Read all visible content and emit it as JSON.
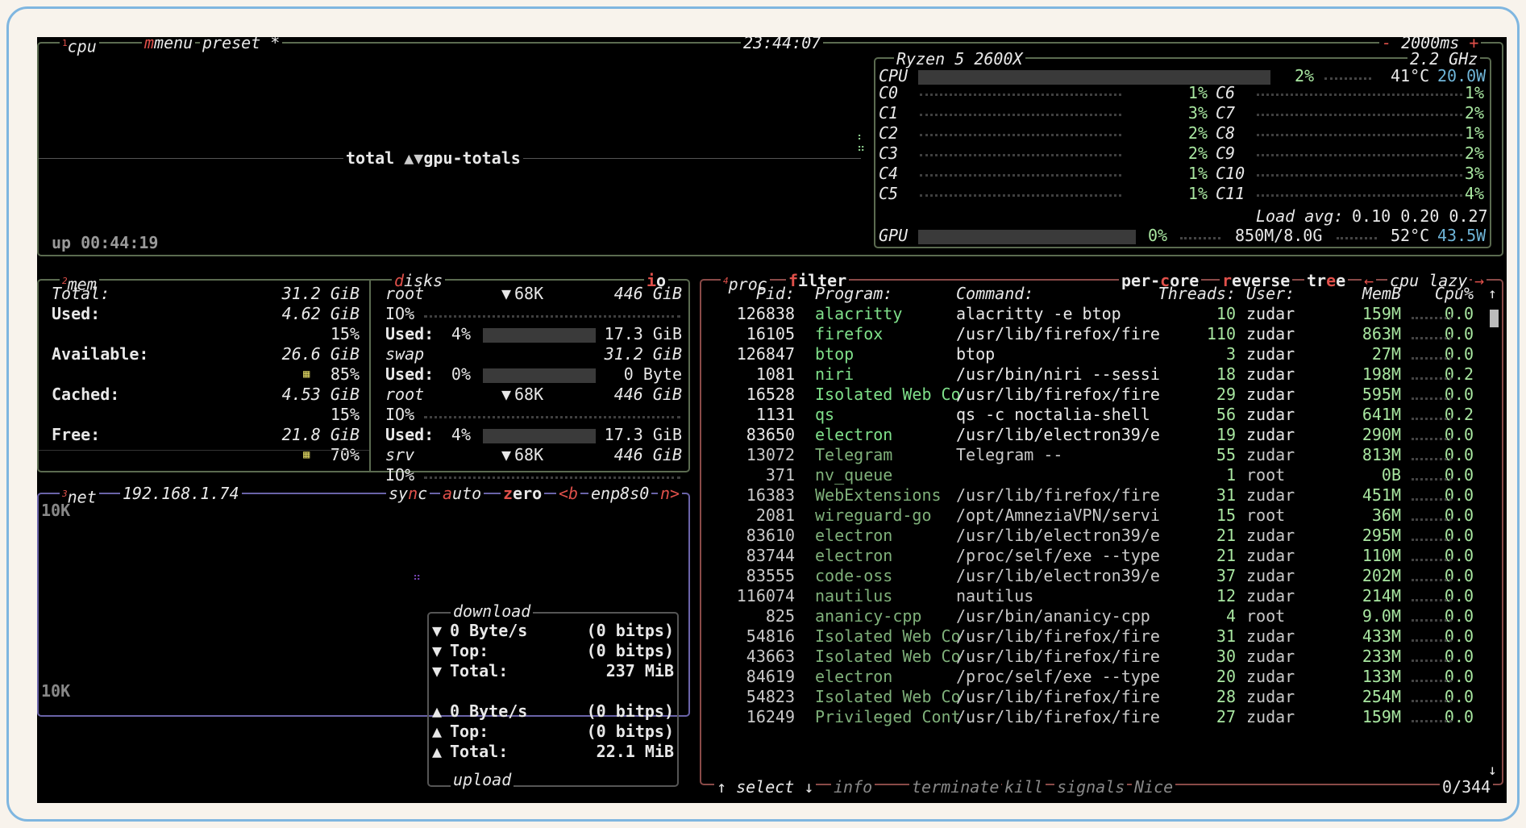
{
  "cpu_box": {
    "tab_num": "1",
    "tab_label": "cpu",
    "menu": "menu",
    "preset": "preset *",
    "clock": "23:44:07",
    "interval_minus": "-",
    "interval": "2000ms",
    "interval_plus": "+",
    "graph_label_total": "total",
    "graph_label_gpu": "gpu-totals",
    "uptime": "up 00:44:19",
    "cpu_model": "Ryzen 5 2600X",
    "freq": "2.2 GHz",
    "cpu_label": "CPU",
    "cpu_pct": "2%",
    "cpu_temp": "41°C",
    "cpu_power": "20.0W",
    "cores_left": [
      {
        "name": "C0",
        "pct": "1%"
      },
      {
        "name": "C1",
        "pct": "3%"
      },
      {
        "name": "C2",
        "pct": "2%"
      },
      {
        "name": "C3",
        "pct": "2%"
      },
      {
        "name": "C4",
        "pct": "1%"
      },
      {
        "name": "C5",
        "pct": "1%"
      }
    ],
    "cores_right": [
      {
        "name": "C6",
        "pct": "1%"
      },
      {
        "name": "C7",
        "pct": "2%"
      },
      {
        "name": "C8",
        "pct": "1%"
      },
      {
        "name": "C9",
        "pct": "2%"
      },
      {
        "name": "C10",
        "pct": "3%"
      },
      {
        "name": "C11",
        "pct": "4%"
      }
    ],
    "load_label": "Load avg:",
    "load_values": "0.10 0.20 0.27",
    "gpu_label": "GPU",
    "gpu_pct": "0%",
    "gpu_mem": "850M/8.0G",
    "gpu_temp": "52°C",
    "gpu_power": "43.5W"
  },
  "mem_box": {
    "tab_num": "2",
    "tab_label": "mem",
    "rows": [
      {
        "label": "Total:",
        "value": "31.2 GiB"
      },
      {
        "label": "Used:",
        "value": "4.62 GiB",
        "pct": "15%"
      },
      {
        "label": "Available:",
        "value": "26.6 GiB",
        "pct": "85%"
      },
      {
        "label": "Cached:",
        "value": "4.53 GiB",
        "pct": "15%"
      },
      {
        "label": "Free:",
        "value": "21.8 GiB",
        "pct": "70%"
      }
    ]
  },
  "disks_box": {
    "tab_label": "disks",
    "io_label": "io",
    "entries": [
      {
        "name": "root",
        "speed": "68K",
        "size": "446 GiB",
        "io_label": "IO%",
        "used_label": "Used:",
        "used_pct": "4%",
        "used_val": "17.3 GiB"
      },
      {
        "name": "swap",
        "size": "31.2 GiB",
        "used_label": "Used:",
        "used_pct": "0%",
        "used_val": "0 Byte"
      },
      {
        "name": "root",
        "speed": "68K",
        "size": "446 GiB",
        "io_label": "IO%",
        "used_label": "Used:",
        "used_pct": "4%",
        "used_val": "17.3 GiB"
      },
      {
        "name": "srv",
        "speed": "68K",
        "size": "446 GiB",
        "io_label": "IO%"
      }
    ]
  },
  "net_box": {
    "tab_num": "3",
    "tab_label": "net",
    "ip": "192.168.1.74",
    "sync": "sync",
    "auto": "auto",
    "zero": "zero",
    "prev_key": "<b",
    "iface": "enp8s0",
    "next_key": "n>",
    "scale_top": "10K",
    "scale_bottom": "10K",
    "download_title": "download",
    "upload_title": "upload",
    "download": [
      {
        "label": "0 Byte/s",
        "value": "(0 bitps)"
      },
      {
        "label": "Top:",
        "value": "(0 bitps)"
      },
      {
        "label": "Total:",
        "value": "237 MiB"
      }
    ],
    "upload": [
      {
        "label": "0 Byte/s",
        "value": "(0 bitps)"
      },
      {
        "label": "Top:",
        "value": "(0 bitps)"
      },
      {
        "label": "Total:",
        "value": "22.1 MiB"
      }
    ]
  },
  "proc_box": {
    "tab_num": "4",
    "tab_label": "proc",
    "filter": "filter",
    "per_core": "per-core",
    "reverse": "reverse",
    "tree": "tree",
    "sort_left": "←",
    "sort": "cpu lazy",
    "sort_right": "→",
    "headers": {
      "pid": "Pid:",
      "program": "Program:",
      "command": "Command:",
      "threads": "Threads:",
      "user": "User:",
      "mem": "MemB",
      "cpu": "Cpu%"
    },
    "rows": [
      {
        "pid": "126838",
        "program": "alacritty",
        "command": "alacritty -e btop",
        "threads": "10",
        "user": "zudar",
        "mem": "159M",
        "cpu": "0.0",
        "highlight": true
      },
      {
        "pid": "16105",
        "program": "firefox",
        "command": "/usr/lib/firefox/fire",
        "threads": "110",
        "user": "zudar",
        "mem": "863M",
        "cpu": "0.0",
        "highlight": true
      },
      {
        "pid": "126847",
        "program": "btop",
        "command": "btop",
        "threads": "3",
        "user": "zudar",
        "mem": "27M",
        "cpu": "0.0",
        "highlight": true
      },
      {
        "pid": "1081",
        "program": "niri",
        "command": "/usr/bin/niri --sessi",
        "threads": "18",
        "user": "zudar",
        "mem": "198M",
        "cpu": "0.2",
        "highlight": true
      },
      {
        "pid": "16528",
        "program": "Isolated Web Co",
        "command": "/usr/lib/firefox/fire",
        "threads": "29",
        "user": "zudar",
        "mem": "595M",
        "cpu": "0.0",
        "highlight": true
      },
      {
        "pid": "1131",
        "program": "qs",
        "command": "qs -c noctalia-shell",
        "threads": "56",
        "user": "zudar",
        "mem": "641M",
        "cpu": "0.2",
        "highlight": true
      },
      {
        "pid": "83650",
        "program": "electron",
        "command": "/usr/lib/electron39/e",
        "threads": "19",
        "user": "zudar",
        "mem": "290M",
        "cpu": "0.0",
        "highlight": true
      },
      {
        "pid": "13072",
        "program": "Telegram",
        "command": "Telegram --",
        "threads": "55",
        "user": "zudar",
        "mem": "813M",
        "cpu": "0.0",
        "highlight": false
      },
      {
        "pid": "371",
        "program": "nv_queue",
        "command": "",
        "threads": "1",
        "user": "root",
        "mem": "0B",
        "cpu": "0.0",
        "highlight": false
      },
      {
        "pid": "16383",
        "program": "WebExtensions",
        "command": "/usr/lib/firefox/fire",
        "threads": "31",
        "user": "zudar",
        "mem": "451M",
        "cpu": "0.0",
        "highlight": false
      },
      {
        "pid": "2081",
        "program": "wireguard-go",
        "command": "/opt/AmneziaVPN/servi",
        "threads": "15",
        "user": "root",
        "mem": "36M",
        "cpu": "0.0",
        "highlight": false
      },
      {
        "pid": "83610",
        "program": "electron",
        "command": "/usr/lib/electron39/e",
        "threads": "21",
        "user": "zudar",
        "mem": "295M",
        "cpu": "0.0",
        "highlight": false
      },
      {
        "pid": "83744",
        "program": "electron",
        "command": "/proc/self/exe --type",
        "threads": "21",
        "user": "zudar",
        "mem": "110M",
        "cpu": "0.0",
        "highlight": false
      },
      {
        "pid": "83555",
        "program": "code-oss",
        "command": "/usr/lib/electron39/e",
        "threads": "37",
        "user": "zudar",
        "mem": "202M",
        "cpu": "0.0",
        "highlight": false
      },
      {
        "pid": "116074",
        "program": "nautilus",
        "command": "nautilus",
        "threads": "12",
        "user": "zudar",
        "mem": "214M",
        "cpu": "0.0",
        "highlight": false
      },
      {
        "pid": "825",
        "program": "ananicy-cpp",
        "command": "/usr/bin/ananicy-cpp",
        "threads": "4",
        "user": "root",
        "mem": "9.0M",
        "cpu": "0.0",
        "highlight": false
      },
      {
        "pid": "54816",
        "program": "Isolated Web Co",
        "command": "/usr/lib/firefox/fire",
        "threads": "31",
        "user": "zudar",
        "mem": "433M",
        "cpu": "0.0",
        "highlight": false
      },
      {
        "pid": "43663",
        "program": "Isolated Web Co",
        "command": "/usr/lib/firefox/fire",
        "threads": "30",
        "user": "zudar",
        "mem": "233M",
        "cpu": "0.0",
        "highlight": false
      },
      {
        "pid": "84619",
        "program": "electron",
        "command": "/proc/self/exe --type",
        "threads": "20",
        "user": "zudar",
        "mem": "133M",
        "cpu": "0.0",
        "highlight": false
      },
      {
        "pid": "54823",
        "program": "Isolated Web Co",
        "command": "/usr/lib/firefox/fire",
        "threads": "28",
        "user": "zudar",
        "mem": "254M",
        "cpu": "0.0",
        "highlight": false
      },
      {
        "pid": "16249",
        "program": "Privileged Cont",
        "command": "/usr/lib/firefox/fire",
        "threads": "27",
        "user": "zudar",
        "mem": "159M",
        "cpu": "0.0",
        "highlight": false
      }
    ],
    "footer": {
      "select": "↑ select ↓",
      "info": "info",
      "terminate": "terminate",
      "kill": "kill",
      "signals": "signals",
      "nice": "Nice",
      "count": "0/344"
    }
  },
  "colors": {
    "background": "#000000",
    "border": "#5b6b50",
    "accent_red": "#e0504a",
    "green": "#8fd18f",
    "cyan": "#6fb5d8"
  }
}
